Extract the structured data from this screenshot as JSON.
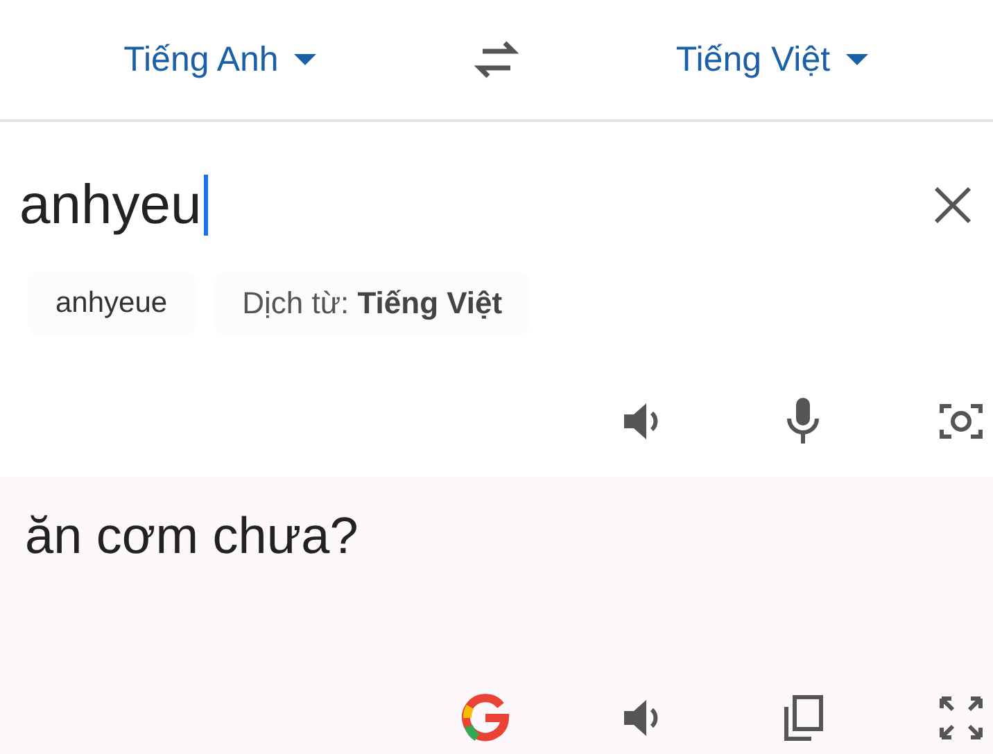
{
  "languages": {
    "source": "Tiếng Anh",
    "target": "Tiếng Việt"
  },
  "input": {
    "value": "anhyeu",
    "focused": true
  },
  "suggestions": [
    {
      "kind": "correction",
      "text": "anhyeue"
    },
    {
      "kind": "detect",
      "prefix": "Dịch từ:",
      "language": "Tiếng Việt"
    }
  ],
  "output": {
    "text": "ăn cơm chưa?"
  }
}
